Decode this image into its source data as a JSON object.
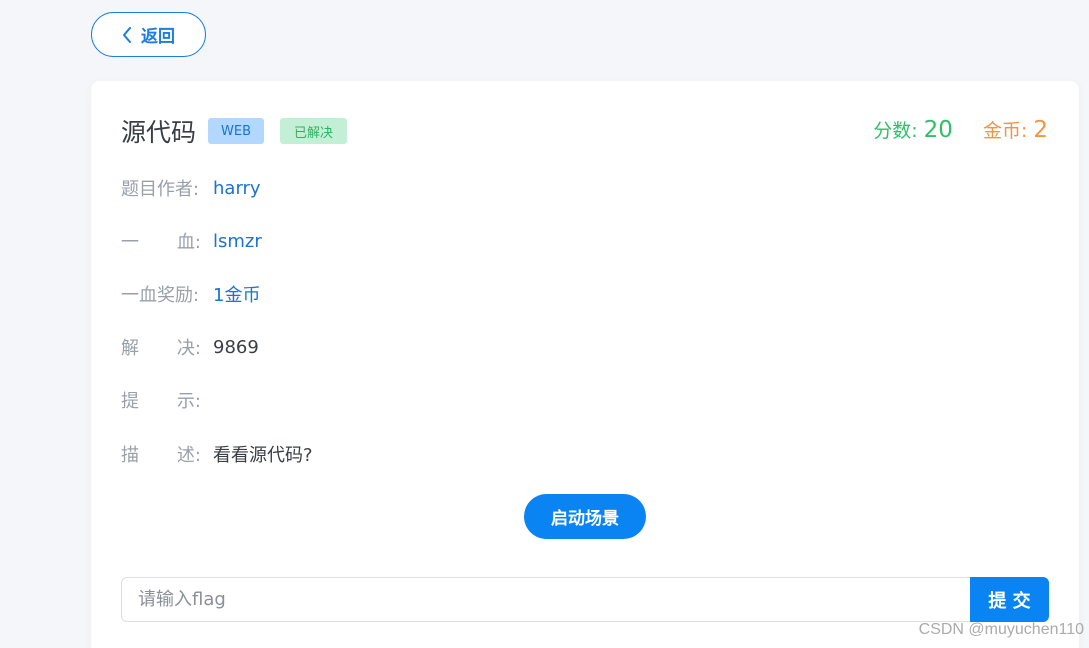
{
  "header": {
    "back_label": "返回"
  },
  "challenge": {
    "title": "源代码",
    "category_tag": "WEB",
    "status_tag": "已解决",
    "score_label": "分数:",
    "score_value": "20",
    "coin_label": "金币:",
    "coin_value": "2"
  },
  "info": {
    "author": {
      "label_parts": [
        "题目作者:"
      ],
      "value": "harry"
    },
    "first_blood": {
      "label_parts": [
        "一",
        "血:"
      ],
      "value": "lsmzr"
    },
    "first_blood_reward": {
      "label_parts": [
        "一血奖励:"
      ],
      "value": "1金币"
    },
    "solves": {
      "label_parts": [
        "解",
        "决:"
      ],
      "value": "9869"
    },
    "hint": {
      "label_parts": [
        "提",
        "示:"
      ],
      "value": ""
    },
    "description": {
      "label_parts": [
        "描",
        "述:"
      ],
      "value": "看看源代码?"
    }
  },
  "actions": {
    "start_label": "启动场景",
    "flag_placeholder": "请输入flag",
    "submit_label": "提 交"
  },
  "watermark": "CSDN @muyuchen110",
  "colors": {
    "primary": "#0b84f3",
    "link": "#1a73d6",
    "score": "#2fbf6a",
    "coin": "#f3953f",
    "label": "#9aa0aa",
    "tag_web_bg": "#b3d8ff",
    "tag_solved_bg": "#c3efd6"
  },
  "icons": {
    "back": "chevron-left-icon"
  }
}
